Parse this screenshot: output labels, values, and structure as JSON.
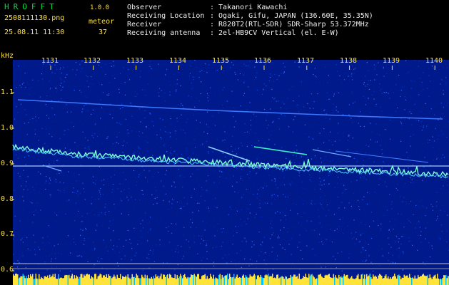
{
  "header": {
    "logo": "HROFFT",
    "version": "1.0.0",
    "filename": "2508111130.png",
    "datetime": "25.08.11 11:30",
    "meteor_label": "meteor",
    "meteor_count": "37"
  },
  "info": {
    "labels": [
      "Observer",
      "Receiving Location",
      "Receiver",
      "Receiving antenna"
    ],
    "values": [
      ": Takanori Kawachi",
      ": Ogaki, Gifu, JAPAN (136.60E, 35.35N)",
      ": R820T2(RTL-SDR) SDR-Sharp 53.372MHz",
      ": 2el-HB9CV Vertical (el. E-W)"
    ]
  },
  "axes": {
    "y_unit": "kHz",
    "y_ticks": [
      "1.1",
      "1.0",
      "0.9",
      "0.8",
      "0.7",
      "0.6"
    ],
    "x_ticks": [
      "1131",
      "1132",
      "1133",
      "1134",
      "1135",
      "1136",
      "1137",
      "1138",
      "1139",
      "1140"
    ]
  },
  "colors": {
    "background": "#000000",
    "noise_base": "#001a8c",
    "trace": "#7fffd4",
    "text_green": "#00e040",
    "text_yellow": "#ffe23a",
    "grid": "#b0b0b0"
  }
}
